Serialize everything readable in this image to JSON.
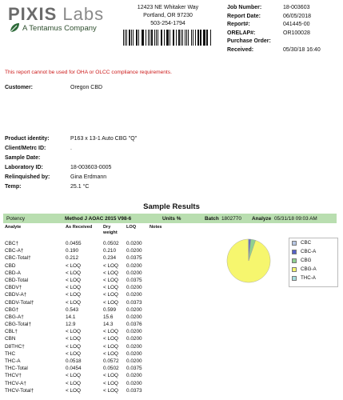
{
  "header": {
    "logo": {
      "brand": "PIXIS",
      "brand2": " Labs",
      "tagline": "A Tentamus Company"
    },
    "lab_address": [
      "12423 NE Whitaker Way",
      "Portland, OR 97230",
      "503-254-1794"
    ],
    "job_info": [
      {
        "label": "Job Number:",
        "value": "18-003603"
      },
      {
        "label": "Report Date:",
        "value": "06/05/2018"
      },
      {
        "label": "Report#:",
        "value": "041445-00"
      },
      {
        "label": "ORELAP#:",
        "value": "OR100028"
      },
      {
        "label": "Purchase Order:",
        "value": ""
      },
      {
        "label": "Received:",
        "value": "05/30/18  16:40"
      }
    ]
  },
  "disclaimer": "This report cannot be used for OHA or OLCC compliance requirements.",
  "customer": {
    "label": "Customer:",
    "value": "Oregon CBD"
  },
  "sample_fields": [
    {
      "label": "Product identity:",
      "value": "P163 x 13-1 Auto CBG \"Q\""
    },
    {
      "label": "Client/Metrc ID:",
      "value": "."
    },
    {
      "label": "Sample Date:",
      "value": ""
    },
    {
      "label": "Laboratory ID:",
      "value": "18-003603-0005"
    },
    {
      "label": "Relinquished by:",
      "value": "Gina Erdmann"
    },
    {
      "label": "Temp:",
      "value": "25.1 °C"
    }
  ],
  "sample_results_title": "Sample Results",
  "potency_bar": {
    "section": "Potency",
    "method": "Method J AOAC 2015 V98-6",
    "units": "Units %",
    "batch_label": "Batch",
    "batch": "1802770",
    "analyze_label": "Analyze",
    "analyze": "05/31/18  09:03 AM"
  },
  "columns": {
    "analyte": "Analyte",
    "as_received": "As Received",
    "dry_weight": "Dry weight",
    "loq": "LOQ",
    "notes": "Notes"
  },
  "rows": [
    {
      "analyte": "CBC†",
      "as_received": "0.0455",
      "dry": "0.0502",
      "loq": "0.0200"
    },
    {
      "analyte": "CBC-A†",
      "as_received": "0.190",
      "dry": "0.210",
      "loq": "0.0200"
    },
    {
      "analyte": "CBC-Total†",
      "as_received": "0.212",
      "dry": "0.234",
      "loq": "0.0375"
    },
    {
      "analyte": "CBD",
      "as_received": "< LOQ",
      "dry": "< LOQ",
      "loq": "0.0200"
    },
    {
      "analyte": "CBD-A",
      "as_received": "< LOQ",
      "dry": "< LOQ",
      "loq": "0.0200"
    },
    {
      "analyte": "CBD-Total",
      "as_received": "< LOQ",
      "dry": "< LOQ",
      "loq": "0.0375"
    },
    {
      "analyte": "CBDV†",
      "as_received": "< LOQ",
      "dry": "< LOQ",
      "loq": "0.0200"
    },
    {
      "analyte": "CBDV-A†",
      "as_received": "< LOQ",
      "dry": "< LOQ",
      "loq": "0.0200"
    },
    {
      "analyte": "CBDV-Total†",
      "as_received": "< LOQ",
      "dry": "< LOQ",
      "loq": "0.0373"
    },
    {
      "analyte": "CBG†",
      "as_received": "0.543",
      "dry": "0.599",
      "loq": "0.0200"
    },
    {
      "analyte": "CBG-A†",
      "as_received": "14.1",
      "dry": "15.6",
      "loq": "0.0200"
    },
    {
      "analyte": "CBG-Total†",
      "as_received": "12.9",
      "dry": "14.3",
      "loq": "0.0376"
    },
    {
      "analyte": "CBL†",
      "as_received": "< LOQ",
      "dry": "< LOQ",
      "loq": "0.0200"
    },
    {
      "analyte": "CBN",
      "as_received": "< LOQ",
      "dry": "< LOQ",
      "loq": "0.0200"
    },
    {
      "analyte": "D8THC†",
      "as_received": "< LOQ",
      "dry": "< LOQ",
      "loq": "0.0200"
    },
    {
      "analyte": "THC",
      "as_received": "< LOQ",
      "dry": "< LOQ",
      "loq": "0.0200"
    },
    {
      "analyte": "THC-A",
      "as_received": "0.0518",
      "dry": "0.0572",
      "loq": "0.0200"
    },
    {
      "analyte": "THC-Total",
      "as_received": "0.0454",
      "dry": "0.0502",
      "loq": "0.0375"
    },
    {
      "analyte": "THCV†",
      "as_received": "< LOQ",
      "dry": "< LOQ",
      "loq": "0.0200"
    },
    {
      "analyte": "THCV-A†",
      "as_received": "< LOQ",
      "dry": "< LOQ",
      "loq": "0.0200"
    },
    {
      "analyte": "THCV-Total†",
      "as_received": "< LOQ",
      "dry": "< LOQ",
      "loq": "0.0373"
    }
  ],
  "chart_data": {
    "type": "pie",
    "title": "",
    "slices": [
      {
        "name": "CBC",
        "value": 0.0455,
        "color": "#b7c6e3"
      },
      {
        "name": "CBC-A",
        "value": 0.19,
        "color": "#5560c8"
      },
      {
        "name": "CBG",
        "value": 0.543,
        "color": "#8fd08f"
      },
      {
        "name": "CBG-A",
        "value": 14.1,
        "color": "#f6f66e"
      },
      {
        "name": "THC-A",
        "value": 0.0518,
        "color": "#a7dede"
      }
    ],
    "legend": "right"
  }
}
